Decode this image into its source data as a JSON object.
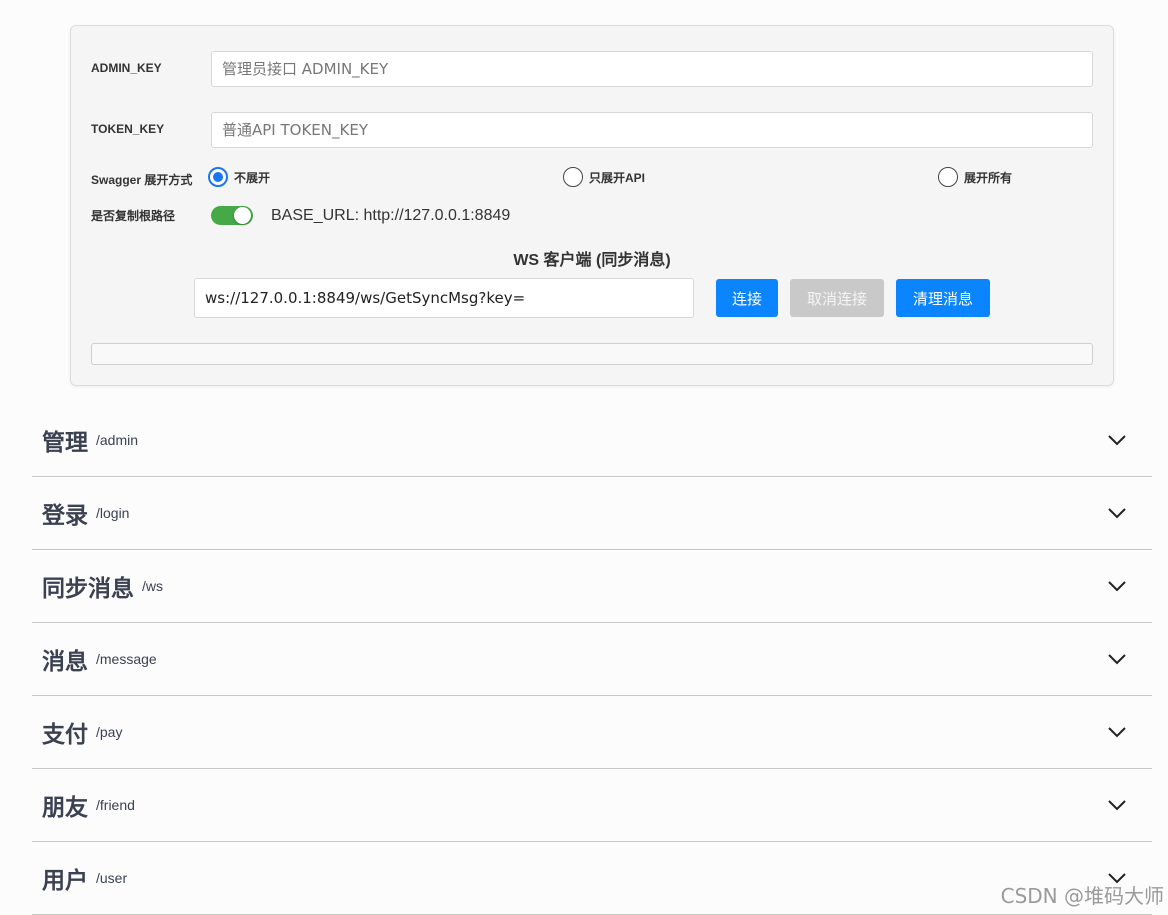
{
  "auth": {
    "admin_key_label": "ADMIN_KEY",
    "admin_key_placeholder": "管理员接口 ADMIN_KEY",
    "token_key_label": "TOKEN_KEY",
    "token_key_placeholder": "普通API TOKEN_KEY"
  },
  "swagger": {
    "label": "Swagger 展开方式",
    "options": [
      {
        "label": "不展开",
        "checked": true
      },
      {
        "label": "只展开API",
        "checked": false
      },
      {
        "label": "展开所有",
        "checked": false
      }
    ]
  },
  "copy_root": {
    "label": "是否复制根路径",
    "enabled": true,
    "base_url_text": "BASE_URL: http://127.0.0.1:8849"
  },
  "ws_client": {
    "title": "WS 客户端 (同步消息)",
    "url_value": "ws://127.0.0.1:8849/ws/GetSyncMsg?key=",
    "connect_label": "连接",
    "disconnect_label": "取消连接",
    "clear_label": "清理消息",
    "messages": ""
  },
  "sections": [
    {
      "title": "管理",
      "path": "/admin"
    },
    {
      "title": "登录",
      "path": "/login"
    },
    {
      "title": "同步消息",
      "path": "/ws"
    },
    {
      "title": "消息",
      "path": "/message"
    },
    {
      "title": "支付",
      "path": "/pay"
    },
    {
      "title": "朋友",
      "path": "/friend"
    },
    {
      "title": "用户",
      "path": "/user"
    }
  ],
  "watermark": "CSDN @堆码大师",
  "colors": {
    "primary_button": "#0a84ff",
    "disabled_button": "#c9c9c9",
    "toggle_on": "#46a948",
    "radio_checked": "#1976f3"
  }
}
